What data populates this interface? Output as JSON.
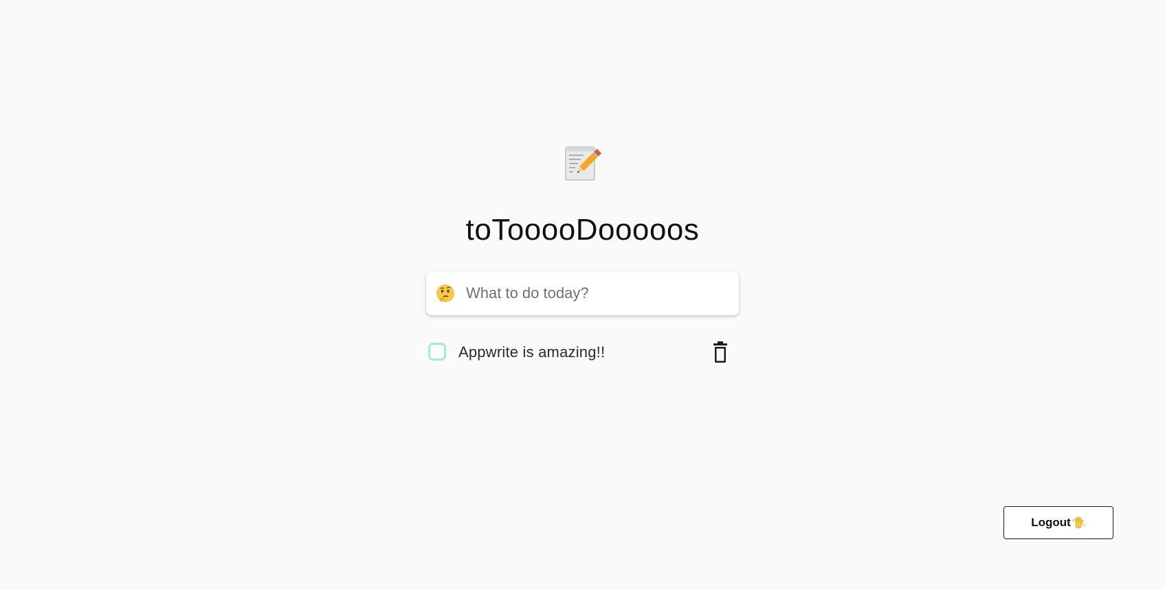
{
  "app": {
    "icon": "memo-pencil-icon",
    "title": "toTooooDooooos"
  },
  "new_task": {
    "icon": "thinking-face-icon",
    "placeholder": "What to do today?",
    "value": ""
  },
  "todos": [
    {
      "text": "Appwrite is amazing!!",
      "completed": false,
      "delete_icon": "trash-icon"
    }
  ],
  "logout": {
    "label": "Logout",
    "icon": "waving-hand-icon"
  },
  "colors": {
    "background": "#fafafa",
    "checkbox_border": "#a3ecd1",
    "text": "#111111"
  }
}
